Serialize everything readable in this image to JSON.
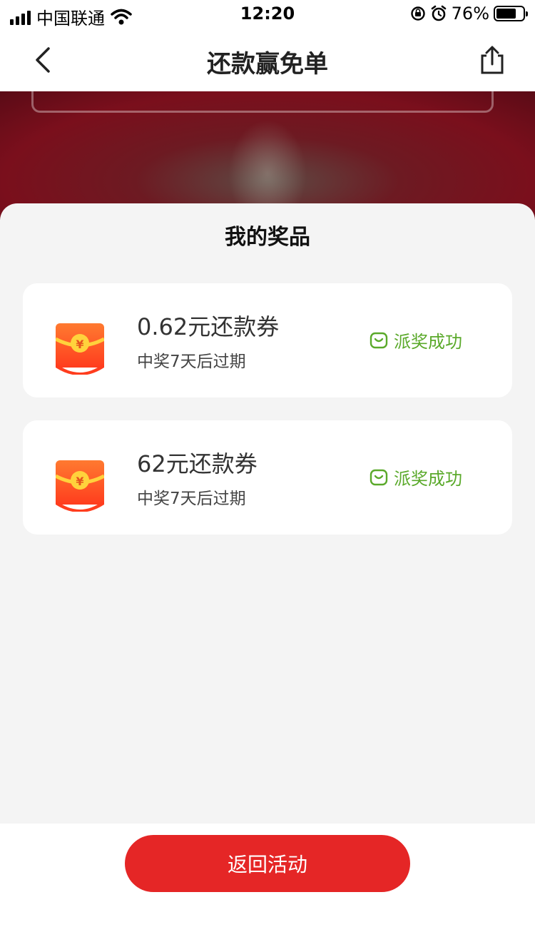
{
  "status_bar": {
    "carrier": "中国联通",
    "time": "12:20",
    "battery_percent": "76%",
    "battery_level": 0.76,
    "icons": [
      "signal-icon",
      "wifi-icon",
      "rotation-lock-icon",
      "alarm-icon",
      "battery-icon"
    ]
  },
  "nav": {
    "title": "还款赢免单",
    "back_icon": "chevron-left-icon",
    "share_icon": "share-icon"
  },
  "sheet": {
    "title": "我的奖品"
  },
  "prizes": [
    {
      "name": "0.62元还款券",
      "expiry": "中奖7天后过期",
      "status": "派奖成功",
      "icon": "red-envelope-icon"
    },
    {
      "name": "62元还款券",
      "expiry": "中奖7天后过期",
      "status": "派奖成功",
      "icon": "red-envelope-icon"
    }
  ],
  "footer": {
    "return_label": "返回活动"
  },
  "colors": {
    "accent_red": "#e52626",
    "success_green": "#5aa92a",
    "envelope_orange": "#ff5a2a",
    "envelope_gold": "#ffd23c"
  }
}
